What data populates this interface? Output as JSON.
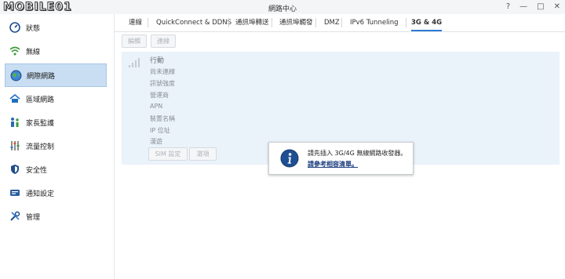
{
  "window": {
    "logo_text": "MOBILE01",
    "title": "網路中心",
    "controls": [
      "?",
      "—",
      "□",
      "✕"
    ]
  },
  "sidebar": {
    "items": [
      {
        "label": "狀態",
        "icon": "gauge-icon"
      },
      {
        "label": "無線",
        "icon": "wifi-icon"
      },
      {
        "label": "網際網路",
        "icon": "globe-icon",
        "active": true
      },
      {
        "label": "區域網路",
        "icon": "house-network-icon"
      },
      {
        "label": "家長監護",
        "icon": "family-icon"
      },
      {
        "label": "流量控制",
        "icon": "sliders-icon"
      },
      {
        "label": "安全性",
        "icon": "shield-icon"
      },
      {
        "label": "通知設定",
        "icon": "notification-icon"
      },
      {
        "label": "管理",
        "icon": "tools-icon"
      }
    ]
  },
  "tabs": [
    {
      "label": "連線"
    },
    {
      "label": "QuickConnect & DDNS"
    },
    {
      "label": "通訊埠轉送"
    },
    {
      "label": "通訊埠觸發"
    },
    {
      "label": "DMZ"
    },
    {
      "label": "IPv6 Tunneling"
    },
    {
      "label": "3G & 4G",
      "active": true
    }
  ],
  "toolbar": {
    "edit_label": "編輯",
    "connect_label": "連線"
  },
  "mobile_panel": {
    "title": "行動",
    "status": "尚未連線",
    "fields": [
      "訊號強度",
      "營運商",
      "APN",
      "裝置名稱",
      "IP 位址",
      "漫遊"
    ],
    "sim_button": "SIM 設定",
    "options_button": "選項"
  },
  "popup": {
    "message": "請先插入 3G/4G 無線網路收發器。",
    "link": "請參考相容清單。",
    "icon": "info-icon"
  }
}
